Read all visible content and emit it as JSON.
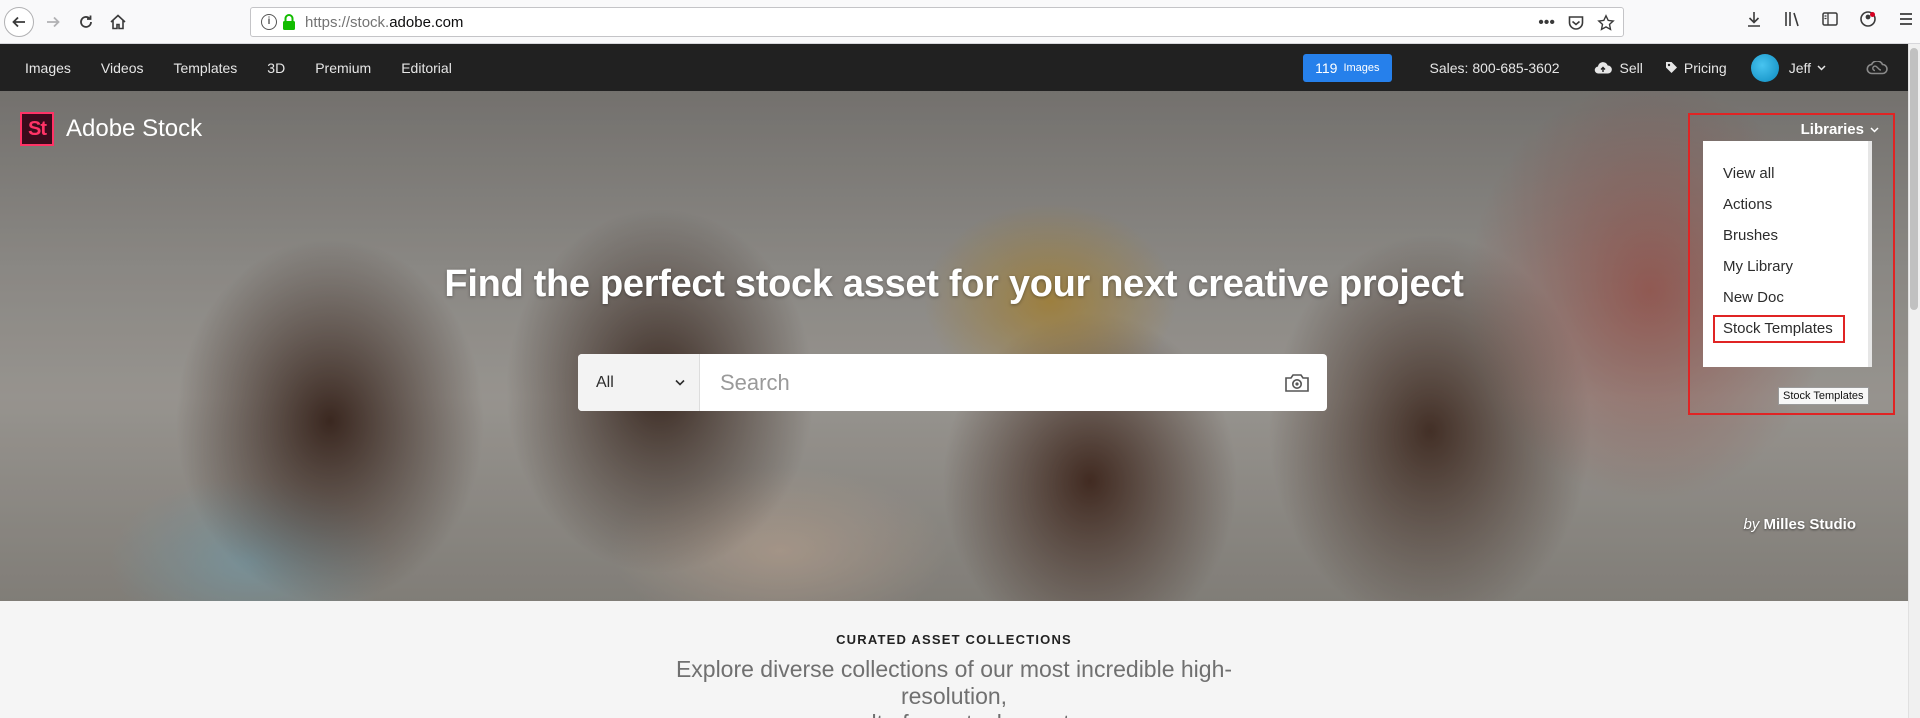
{
  "browser": {
    "url_prefix": "https://stock.",
    "url_domain": "adobe.com",
    "more_actions_icon": "ellipsis-icon",
    "pocket_icon": "pocket-icon",
    "bookmark_icon": "star-icon"
  },
  "site_nav": {
    "items": [
      "Images",
      "Videos",
      "Templates",
      "3D",
      "Premium",
      "Editorial"
    ],
    "cart_count": "119",
    "cart_unit": "Images",
    "sales": "Sales: 800-685-3602",
    "sell": "Sell",
    "pricing": "Pricing",
    "user_name": "Jeff",
    "accent_color": "#2680eb",
    "background_color": "#212121"
  },
  "logo": {
    "mark": "St",
    "name": "Adobe Stock",
    "brand_color": "#ff3366"
  },
  "hero": {
    "headline": "Find the perfect stock asset for your next creative project",
    "credit_by": "by",
    "credit_name": "Milles Studio"
  },
  "search": {
    "category": "All",
    "placeholder": "Search"
  },
  "libraries": {
    "toggle_label": "Libraries",
    "items": [
      "View all",
      "Actions",
      "Brushes",
      "My Library",
      "New Doc",
      "Stock Templates"
    ],
    "selected": "Stock Templates",
    "tooltip": "Stock Templates",
    "highlight_color": "#e02424"
  },
  "curated": {
    "title": "CURATED ASSET COLLECTIONS",
    "description_line1": "Explore diverse collections of our most incredible high-resolution,",
    "description_line2": "royalty-free, stock assets"
  }
}
